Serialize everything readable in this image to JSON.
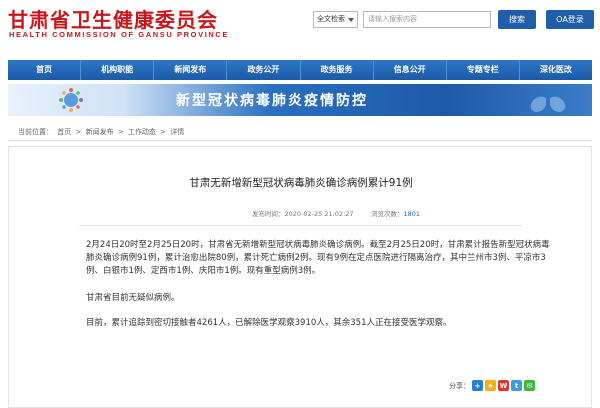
{
  "header": {
    "title": "甘肃省卫生健康委员会",
    "subtitle": "HEALTH COMMISSION OF GANSU PROVINCE",
    "search_scope": "全文检索",
    "search_placeholder": "请输入搜索内容",
    "search_button": "搜索",
    "oa_button": "OA登录"
  },
  "nav": {
    "items": [
      "首页",
      "机构职能",
      "新闻发布",
      "政务公开",
      "政务服务",
      "信息公开",
      "专题专栏",
      "深化医改"
    ]
  },
  "banner": {
    "text": "新型冠状病毒肺炎疫情防控"
  },
  "breadcrumb": {
    "label": "当前位置：",
    "items": [
      "首页",
      "新闻发布",
      "工作动态",
      "详情"
    ],
    "separator": ">"
  },
  "article": {
    "title": "甘肃无新增新型冠状病毒肺炎确诊病例累计91例",
    "published_label": "发布时间：",
    "published": "2020-02-25 21:02:27",
    "views_label": "浏览次数：",
    "views": "1801",
    "paragraphs": [
      "2月24日20时至2月25日20时，甘肃省无新增新型冠状病毒肺炎确诊病例。截至2月25日20时，甘肃累计报告新型冠状病毒肺炎确诊病例91例，累计治愈出院80例，累计死亡病例2例。现有9例在定点医院进行隔离治疗，其中兰州市3例、平凉市3例、白银市1例、定西市1例、庆阳市1例。现有重型病例3例。",
      "甘肃省目前无疑似病例。",
      "目前，累计追踪到密切接触者4261人，已解除医学观察3910人，其余351人正在接受医学观察。"
    ]
  },
  "share": {
    "label": "分享："
  },
  "colors": {
    "brand_red": "#c8161d",
    "nav_blue": "#1f5ea8",
    "link_blue": "#1f5ea8"
  }
}
